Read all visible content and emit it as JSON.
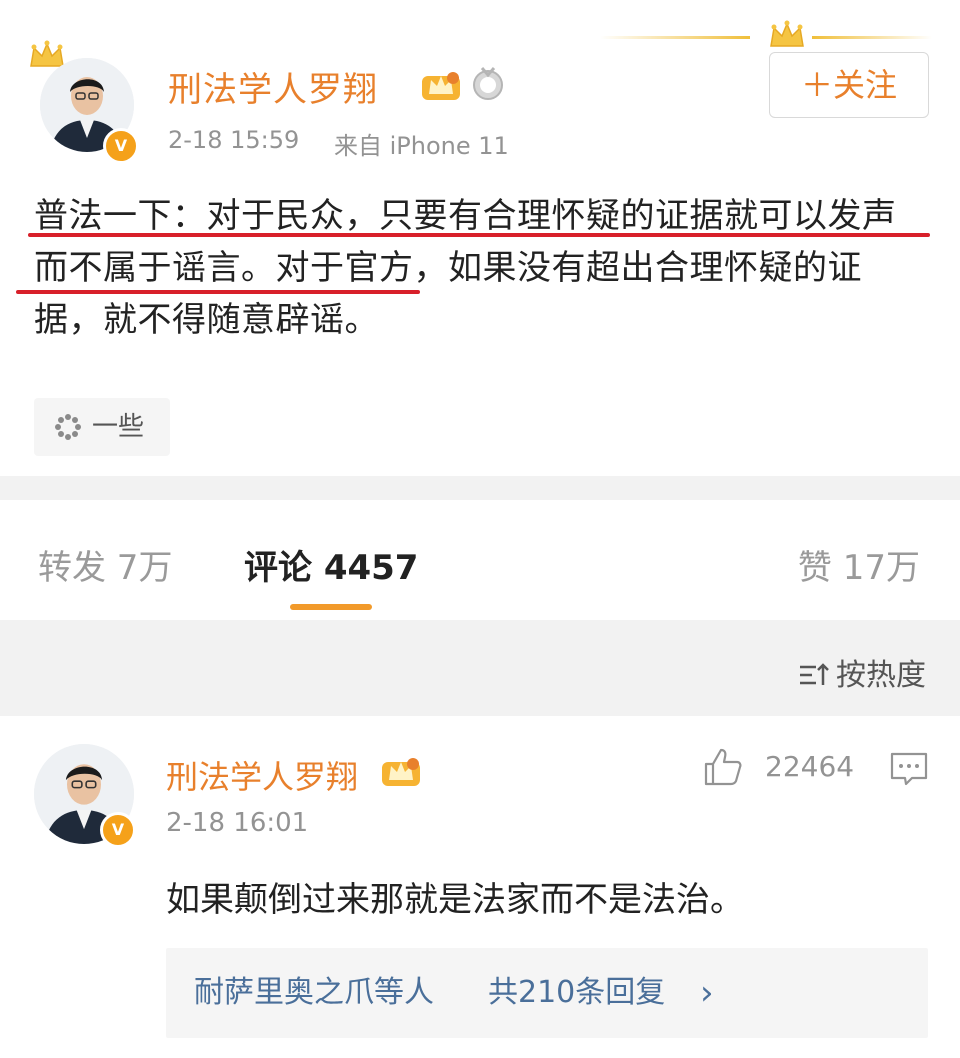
{
  "post": {
    "author": "刑法学人罗翔",
    "timestamp": "2-18 15:59",
    "source": "来自 iPhone 11",
    "follow_label": "＋关注",
    "text": "普法一下：对于民众，只要有合理怀疑的证据就可以发声而不属于谣言。对于官方，如果没有超出合理怀疑的证据，就不得随意辟谣。",
    "topic_chip": "一些",
    "icons": [
      "vip-crown-icon",
      "medal-icon",
      "verified-v-icon",
      "loading-spinner-icon"
    ]
  },
  "tabs": {
    "repost": "转发 7万",
    "comments": "评论 4457",
    "likes": "赞 17万"
  },
  "sort": {
    "label": "按热度",
    "icon": "sort-icon"
  },
  "comment": {
    "author": "刑法学人罗翔",
    "timestamp": "2-18 16:01",
    "likes": "22464",
    "text": "如果颠倒过来那就是法家而不是法治。",
    "replies_users": "耐萨里奥之爪等人",
    "replies_count": "共210条回复",
    "replies_chevron": "›"
  },
  "colors": {
    "accent_orange": "#e8802c",
    "underline_red": "#d8202a",
    "link_blue": "#4a6f9a",
    "muted_gray": "#939393"
  }
}
